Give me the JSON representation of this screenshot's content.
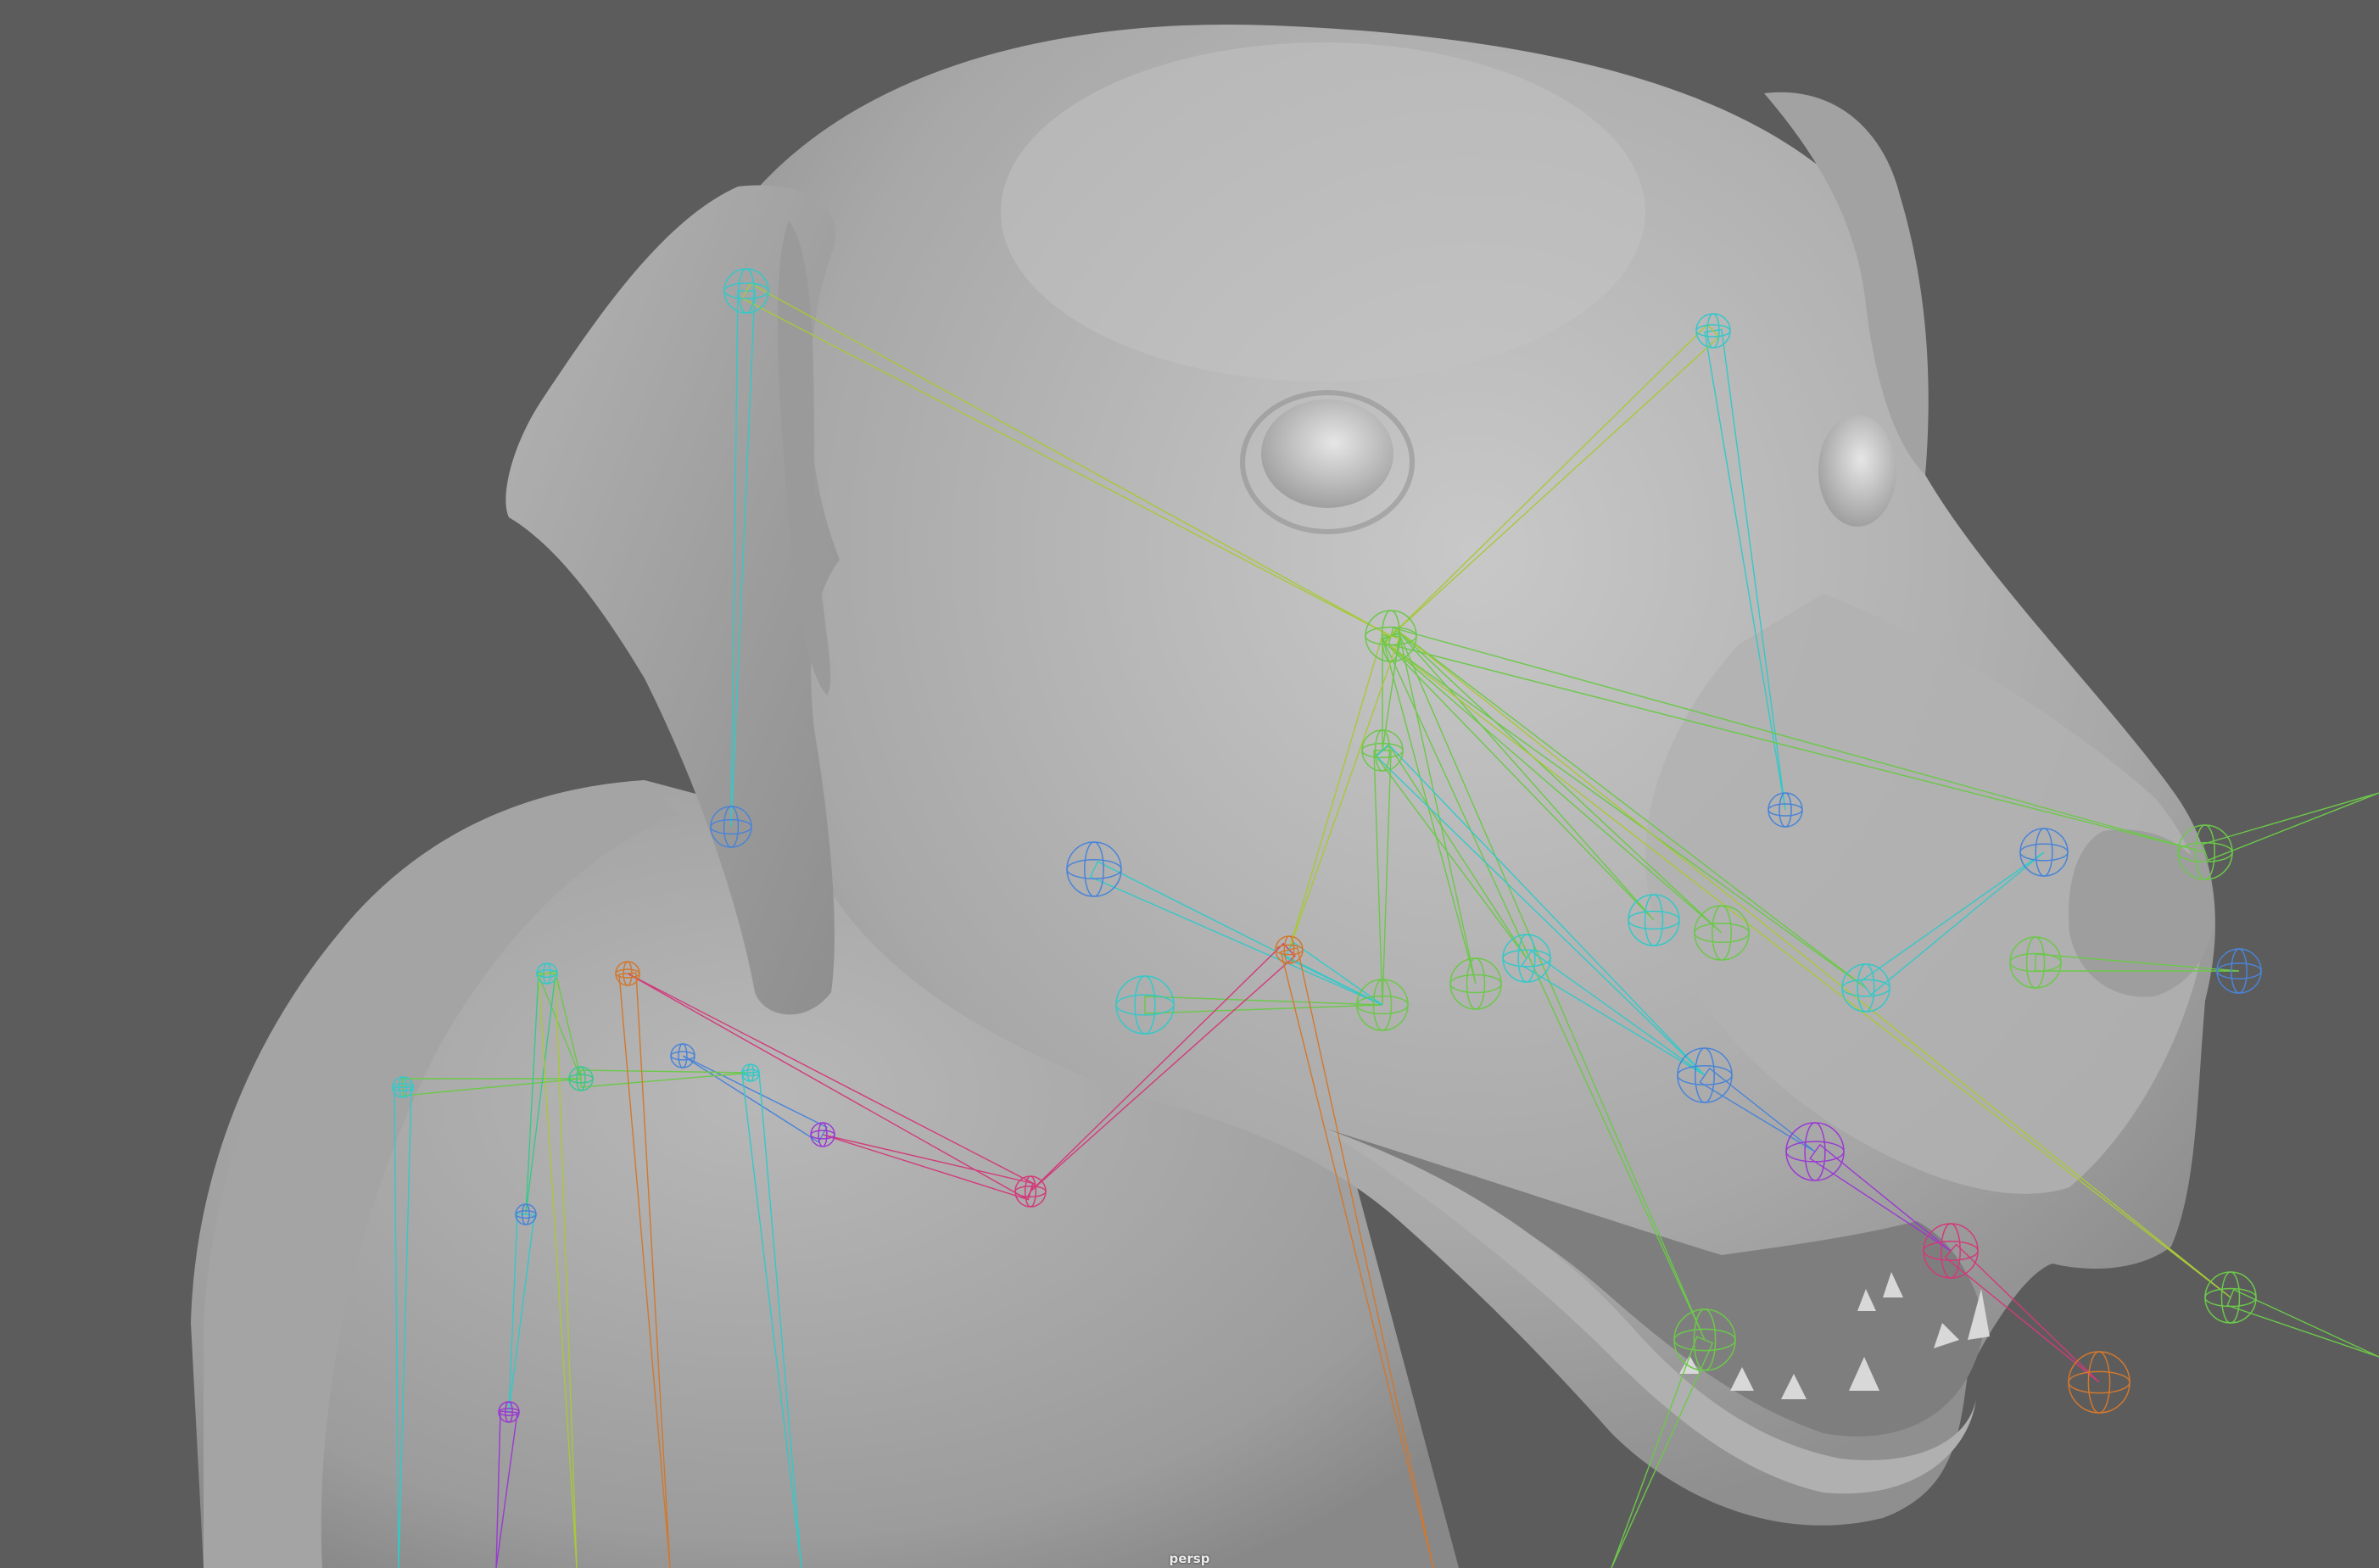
{
  "viewport": {
    "camera": "persp",
    "background_color": "#5c5c5c",
    "mesh_color": "#a9a9a9"
  },
  "joint_colors": {
    "cyan": "#35c8c8",
    "blue": "#4a84d8",
    "green": "#6cc84a",
    "yellow_green": "#a8c83a",
    "orange": "#d2782e",
    "magenta": "#d23a7a",
    "purple": "#9a3ad2",
    "teal_green": "#3ac88a"
  }
}
